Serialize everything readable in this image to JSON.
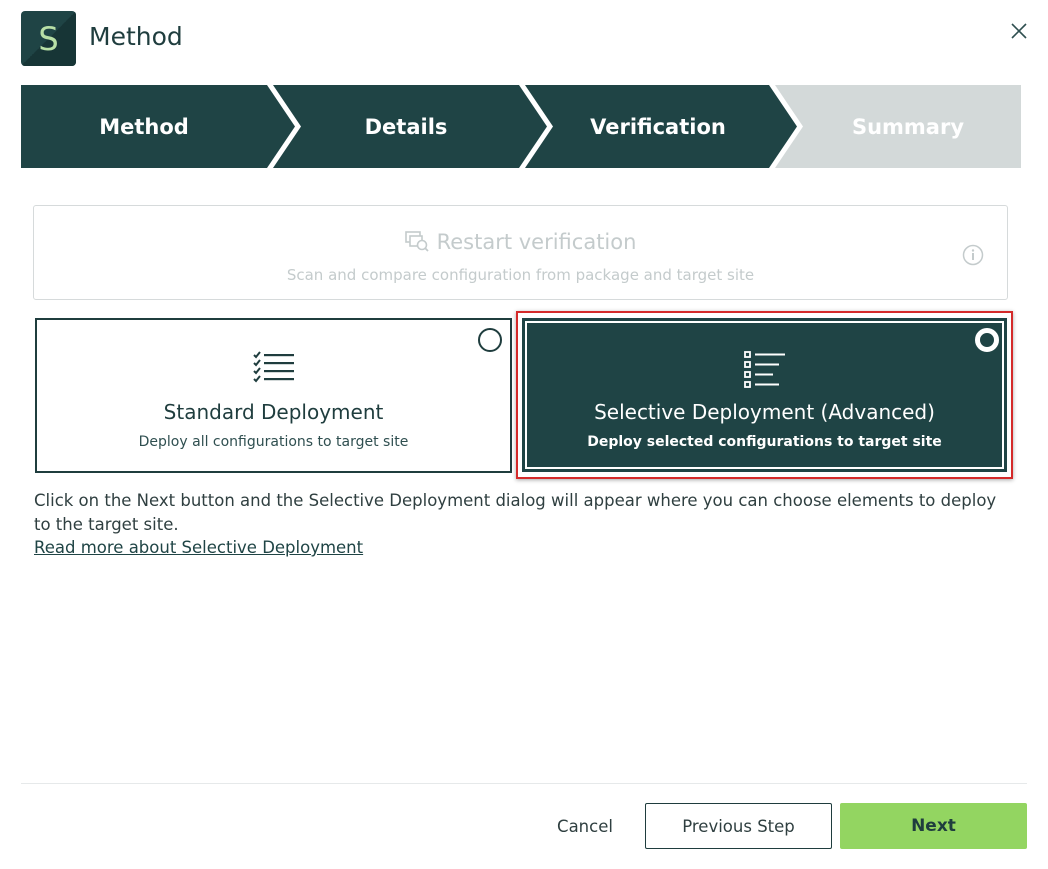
{
  "header": {
    "logo_letter": "S",
    "title": "Method",
    "close_icon": "close-icon"
  },
  "stepper": {
    "steps": [
      {
        "label": "Method",
        "state": "completed"
      },
      {
        "label": "Details",
        "state": "completed"
      },
      {
        "label": "Verification",
        "state": "completed"
      },
      {
        "label": "Summary",
        "state": "inactive"
      }
    ],
    "active_color": "#1f4445",
    "inactive_color": "#d3d9d9"
  },
  "restart": {
    "title": "Restart verification",
    "subtitle": "Scan and compare configuration from package and target site",
    "icon": "restart-verification-icon",
    "info_icon": "info-icon"
  },
  "options": {
    "standard": {
      "title": "Standard Deployment",
      "subtitle": "Deploy all configurations to target site",
      "icon": "checklist-icon",
      "selected": false
    },
    "selective": {
      "title": "Selective Deployment (Advanced)",
      "subtitle": "Deploy selected configurations to target site",
      "icon": "selective-list-icon",
      "selected": true
    }
  },
  "description": {
    "text": "Click on the Next button and the Selective Deployment dialog will appear where you can choose elements to deploy to the target site.",
    "link": "Read more about Selective Deployment"
  },
  "footer": {
    "cancel": "Cancel",
    "previous": "Previous Step",
    "next": "Next"
  },
  "colors": {
    "brand_dark": "#1f4445",
    "accent_green": "#93d561",
    "highlight_red": "#d42a2a"
  }
}
